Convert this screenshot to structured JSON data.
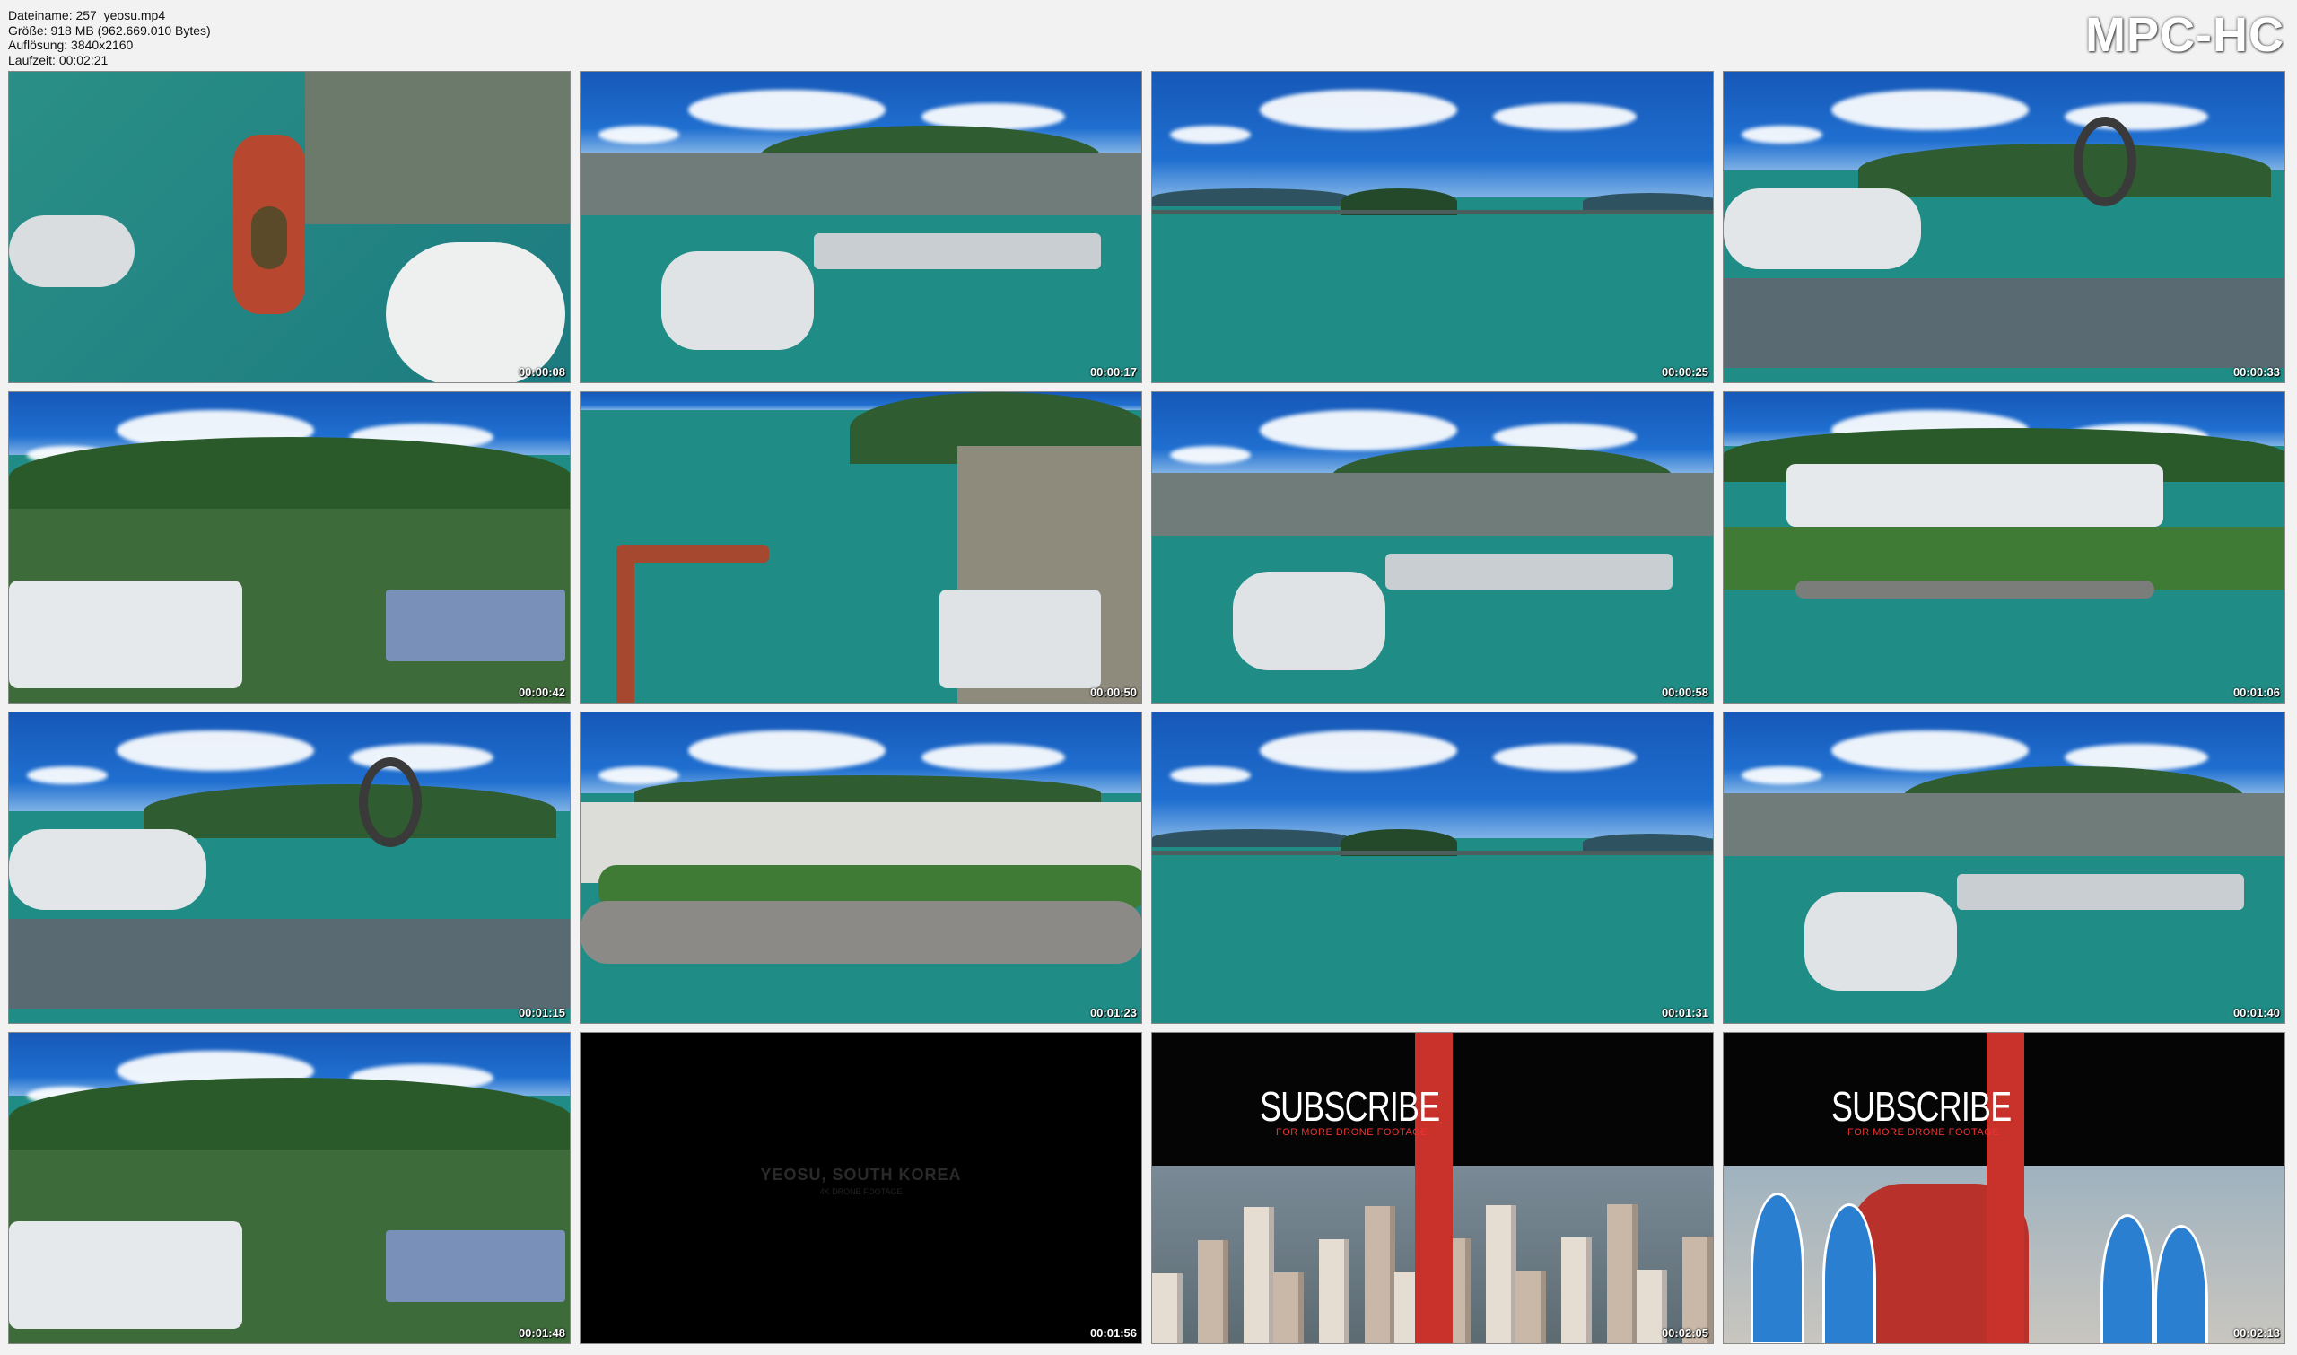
{
  "window": {
    "logo": "MPC-HC",
    "meta_lines": [
      "Dateiname: 257_yeosu.mp4",
      "Größe: 918 MB (962.669.010 Bytes)",
      "Auflösung: 3840x2160",
      "Laufzeit: 00:02:21"
    ]
  },
  "thumbnails": [
    {
      "time": "00:00:08",
      "scene": "aerial-harbor"
    },
    {
      "time": "00:00:17",
      "scene": "city-harbor"
    },
    {
      "time": "00:00:25",
      "scene": "open-sea"
    },
    {
      "time": "00:00:33",
      "scene": "expo-ring"
    },
    {
      "time": "00:00:42",
      "scene": "mountain-city"
    },
    {
      "time": "00:00:50",
      "scene": "harbor-bridge"
    },
    {
      "time": "00:00:58",
      "scene": "city-harbor"
    },
    {
      "time": "00:01:06",
      "scene": "expo-park"
    },
    {
      "time": "00:01:15",
      "scene": "expo-ring"
    },
    {
      "time": "00:01:23",
      "scene": "breakwater-park"
    },
    {
      "time": "00:01:31",
      "scene": "open-sea"
    },
    {
      "time": "00:01:40",
      "scene": "city-harbor"
    },
    {
      "time": "00:01:48",
      "scene": "mountain-city"
    },
    {
      "time": "00:01:56",
      "scene": "black-title",
      "title": "YEOSU, SOUTH KOREA",
      "subtitle": "4K DRONE FOOTAGE"
    },
    {
      "time": "00:02:05",
      "scene": "subscribe-city",
      "word": "SUBSCRIBE",
      "tag": "FOR MORE DRONE FOOTAGE"
    },
    {
      "time": "00:02:13",
      "scene": "subscribe-church",
      "word": "SUBSCRIBE",
      "tag": "FOR MORE DRONE FOOTAGE"
    }
  ],
  "colors": {
    "sky": "#1f6fd0",
    "water": "#1f8c86",
    "land": "#3e6b3a",
    "accent_red": "#c8322a"
  }
}
